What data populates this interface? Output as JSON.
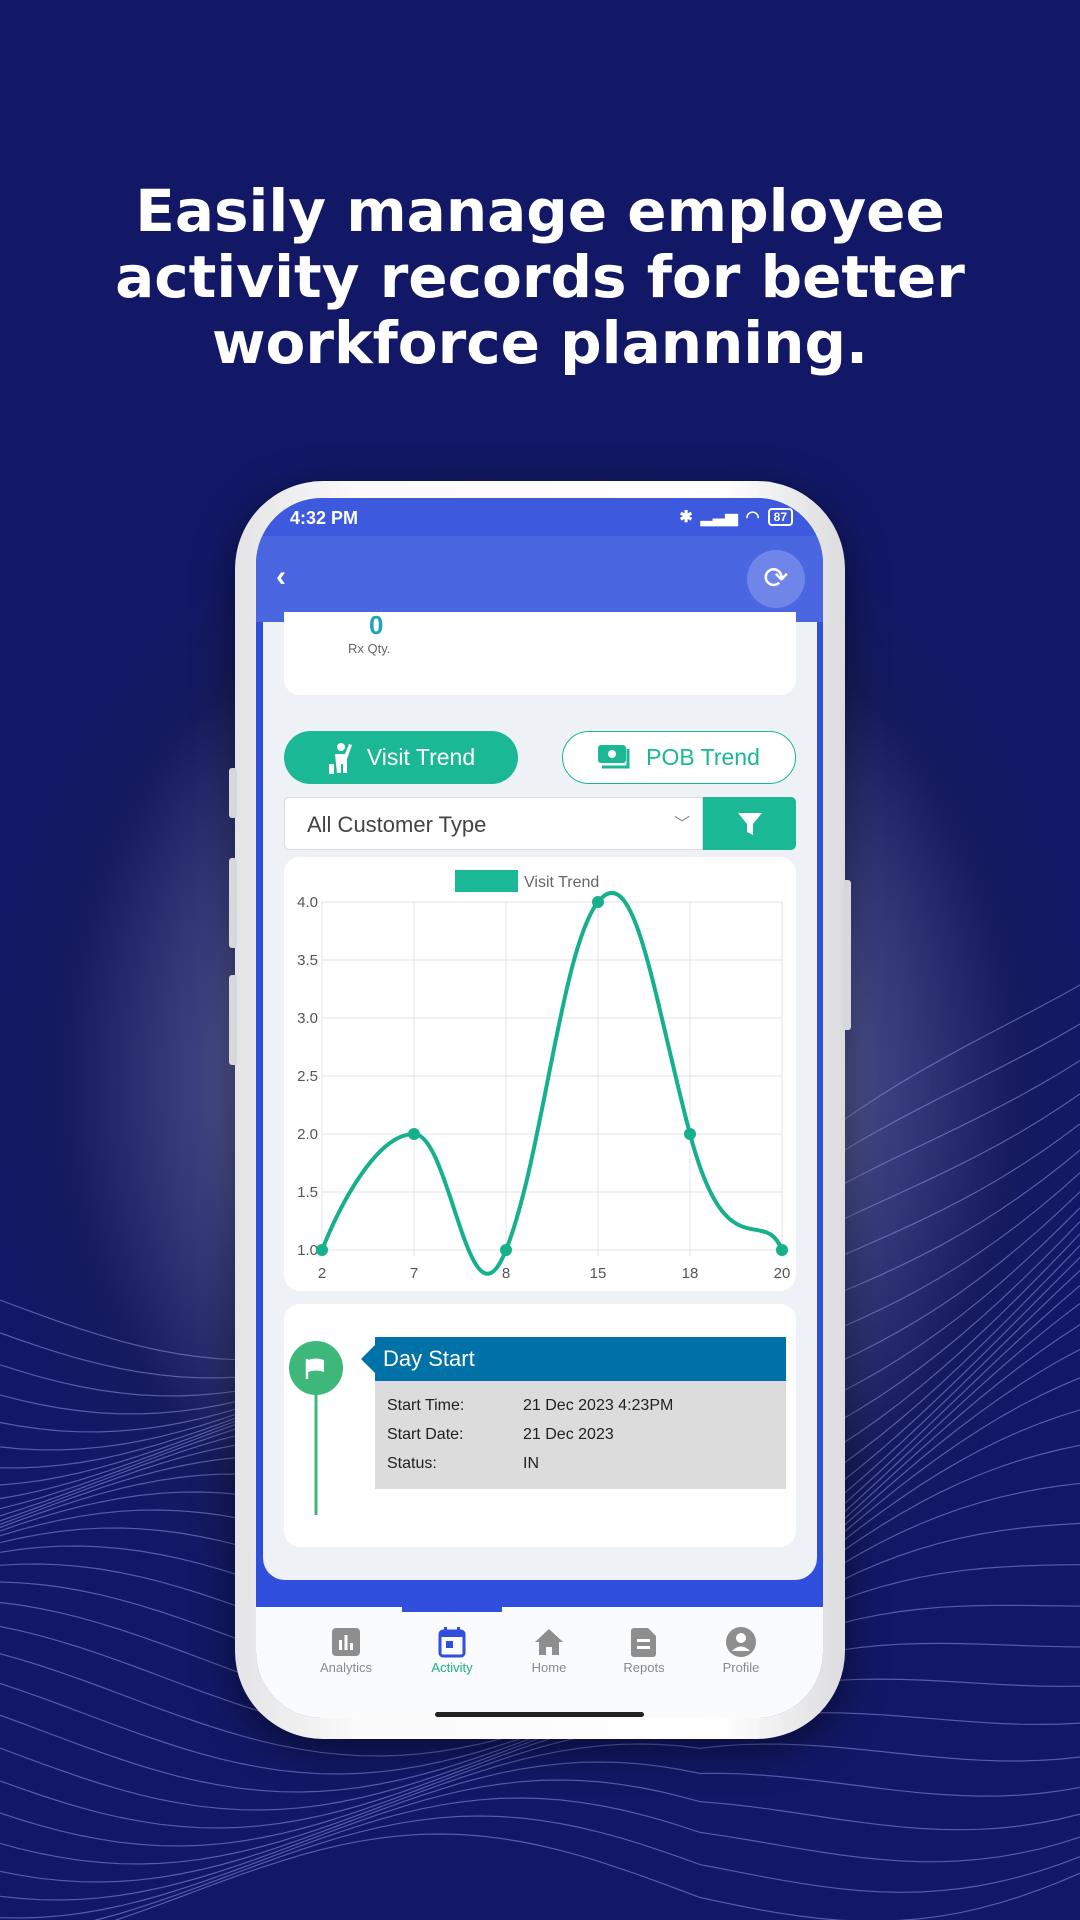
{
  "headline": [
    "Easily manage employee",
    "activity records for better",
    "workforce planning."
  ],
  "status": {
    "time": "4:32 PM",
    "battery": "87"
  },
  "header": {
    "back_icon": "chevron-left-icon",
    "refresh_icon": "refresh-icon"
  },
  "summary": {
    "value": "0",
    "label": "Rx Qty."
  },
  "trend_tabs": [
    {
      "label": "Visit Trend",
      "icon": "person-waving-icon",
      "active": true
    },
    {
      "label": "POB Trend",
      "icon": "money-icon",
      "active": false
    }
  ],
  "filter": {
    "selected": "All Customer Type",
    "button_icon": "filter-icon"
  },
  "colors": {
    "accent": "#1ab894",
    "primary": "#2f4fdc",
    "header": "#4a66e0",
    "day_start": "#0072a8",
    "flag": "#3db87a"
  },
  "chart_data": {
    "type": "line",
    "legend": [
      "Visit Trend"
    ],
    "legend_placement": "top",
    "categories": [
      "2",
      "7",
      "8",
      "15",
      "18",
      "20"
    ],
    "series": [
      {
        "name": "Visit Trend",
        "values": [
          1,
          2,
          1,
          4,
          2,
          1
        ]
      }
    ],
    "ylim": [
      1,
      4
    ],
    "yticks": [
      "1.0",
      "1.5",
      "2.0",
      "2.5",
      "3.0",
      "3.5",
      "4.0"
    ],
    "grid": true,
    "smooth": true
  },
  "day_start": {
    "title": "Day Start",
    "icon": "flag-icon",
    "rows": [
      {
        "label": "Start Time:",
        "value": "21 Dec 2023 4:23PM"
      },
      {
        "label": "Start Date:",
        "value": "21 Dec 2023"
      },
      {
        "label": "Status:",
        "value": "IN"
      }
    ]
  },
  "nav": [
    {
      "label": "Analytics",
      "icon": "bar-chart-icon"
    },
    {
      "label": "Activity",
      "icon": "calendar-icon",
      "active": true
    },
    {
      "label": "Home",
      "icon": "home-icon"
    },
    {
      "label": "Repots",
      "icon": "document-icon"
    },
    {
      "label": "Profile",
      "icon": "profile-icon"
    }
  ]
}
